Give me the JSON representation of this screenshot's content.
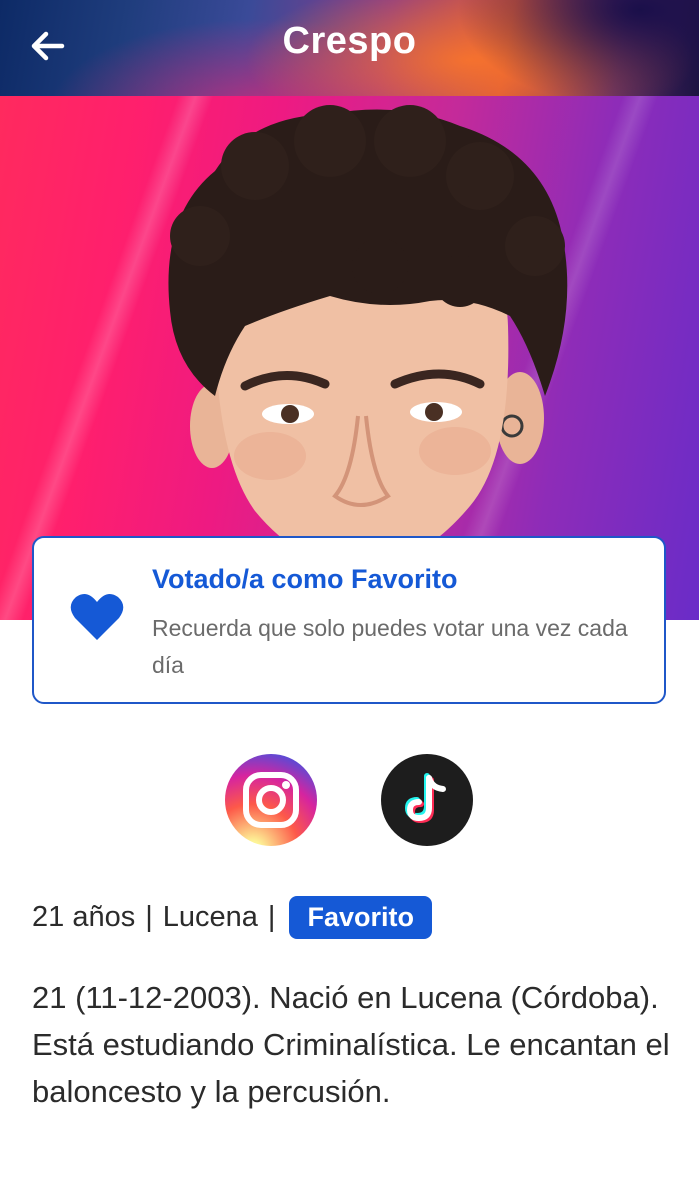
{
  "header": {
    "title": "Crespo",
    "back_icon": "arrow-left-icon"
  },
  "hero": {
    "image": "contestant-portrait",
    "background_colors": [
      "#ff2a5e",
      "#ee1a82",
      "#8e2cb8",
      "#6a2cc8"
    ]
  },
  "vote_card": {
    "icon": "heart-icon",
    "title": "Votado/a como Favorito",
    "subtitle": "Recuerda que solo puedes votar una vez cada día"
  },
  "social": [
    {
      "name": "instagram",
      "icon": "instagram-icon"
    },
    {
      "name": "tiktok",
      "icon": "tiktok-icon"
    }
  ],
  "info": {
    "age": "21 años",
    "separator": "|",
    "city": "Lucena",
    "badge": "Favorito"
  },
  "bio": "21 (11-12-2003). Nació en Lucena (Córdoba). Está estudiando Criminalística. Le encantan el baloncesto y la percusión.",
  "colors": {
    "accent": "#1559d6",
    "text": "#2b2b2b",
    "muted": "#6b6b6b"
  }
}
